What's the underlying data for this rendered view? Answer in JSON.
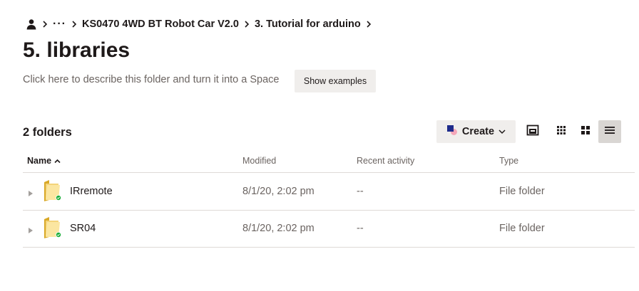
{
  "breadcrumb": {
    "ellipsis": "···",
    "items": [
      "KS0470 4WD BT Robot Car V2.0",
      "3. Tutorial for arduino"
    ]
  },
  "page": {
    "title": "5. libraries",
    "description": "Click here to describe this folder and turn it into a Space",
    "show_examples": "Show examples"
  },
  "toolbar": {
    "count": "2 folders",
    "create": "Create"
  },
  "table": {
    "headers": {
      "name": "Name",
      "modified": "Modified",
      "activity": "Recent activity",
      "type": "Type"
    },
    "rows": [
      {
        "name": "IRremote",
        "modified": "8/1/20, 2:02 pm",
        "activity": "--",
        "type": "File folder"
      },
      {
        "name": "SR04",
        "modified": "8/1/20, 2:02 pm",
        "activity": "--",
        "type": "File folder"
      }
    ]
  },
  "colors": {
    "text": "#1e1919",
    "muted": "#6b6461",
    "button_bg": "#f0eeec",
    "sync_ok": "#1aae39",
    "create_blue": "#1e2b8b",
    "create_pink": "#f4a7b9"
  }
}
